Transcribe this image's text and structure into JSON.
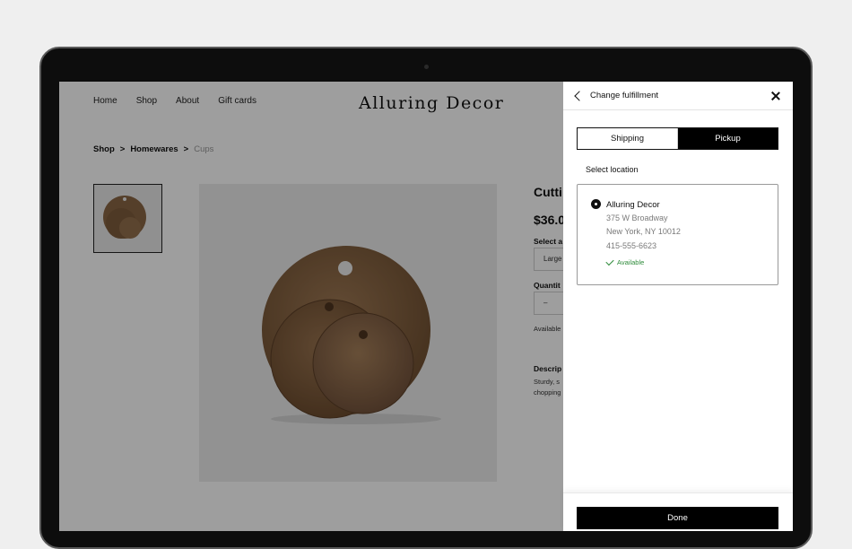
{
  "store": {
    "nav": [
      "Home",
      "Shop",
      "About",
      "Gift cards"
    ],
    "brand": "Alluring Decor",
    "breadcrumb": {
      "a": "Shop",
      "b": "Homewares",
      "c": "Cups",
      "sep": ">"
    },
    "product": {
      "title": "Cutti",
      "price": "$36.0",
      "select_label": "Select a",
      "select_value": "Large",
      "quantity_label": "Quantit",
      "quantity_minus": "–",
      "availability": "Available",
      "description_label": "Descrip",
      "description_line1": "Sturdy, s",
      "description_line2": "chopping"
    }
  },
  "panel": {
    "title": "Change fulfillment",
    "tabs": {
      "shipping": "Shipping",
      "pickup": "Pickup"
    },
    "select_location_label": "Select location",
    "location": {
      "name": "Alluring Decor",
      "address1": "375 W Broadway",
      "address2": "New York, NY 10012",
      "phone": "415-555-6623",
      "status": "Available"
    },
    "done_label": "Done"
  },
  "colors": {
    "accent": "#000000",
    "available": "#2e8b3a",
    "wood": "#8a6644"
  }
}
